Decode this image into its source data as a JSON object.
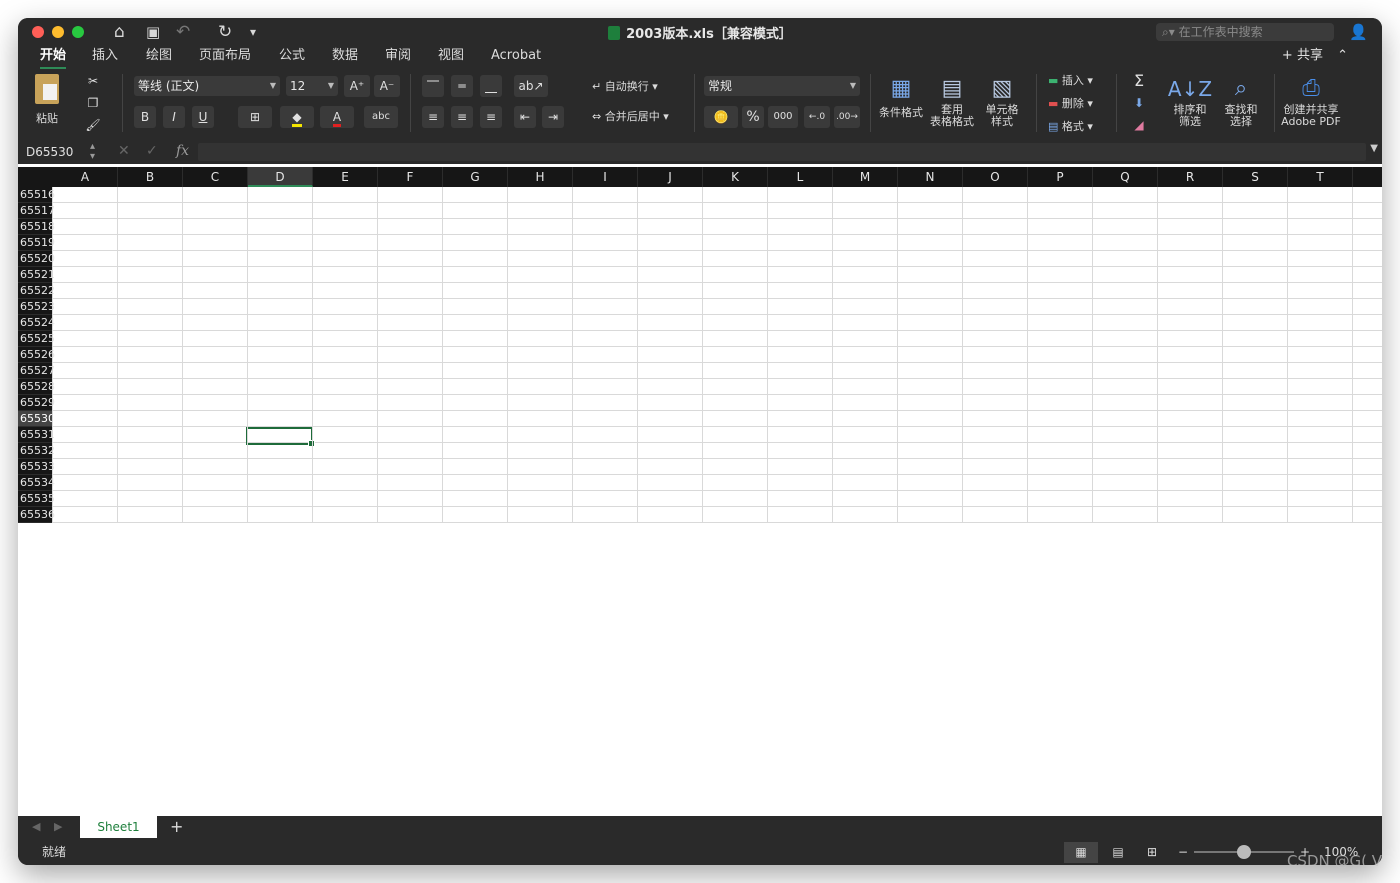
{
  "window": {
    "title": "2003版本.xls［兼容模式］",
    "search_placeholder": "在工作表中搜索",
    "share_label": "共享"
  },
  "tabs": [
    "开始",
    "插入",
    "绘图",
    "页面布局",
    "公式",
    "数据",
    "审阅",
    "视图",
    "Acrobat"
  ],
  "active_tab": "开始",
  "ribbon": {
    "paste": "粘贴",
    "font_name": "等线 (正文)",
    "font_size": "12",
    "bold": "B",
    "italic": "I",
    "underline": "U",
    "wrap_text": "自动换行",
    "merge_center": "合并后居中",
    "number_format": "常规",
    "percent": "%",
    "comma": "000",
    "conditional_format": "条件格式",
    "table_format_1": "套用",
    "table_format_2": "表格格式",
    "cell_style_1": "单元格",
    "cell_style_2": "样式",
    "insert": "插入",
    "delete": "删除",
    "format": "格式",
    "sort_filter_1": "排序和",
    "sort_filter_2": "筛选",
    "find_select_1": "查找和",
    "find_select_2": "选择",
    "adobe_1": "创建并共享",
    "adobe_2": "Adobe PDF"
  },
  "formula_bar": {
    "name_box": "D65530",
    "fx": "fx",
    "value": ""
  },
  "columns": [
    "A",
    "B",
    "C",
    "D",
    "E",
    "F",
    "G",
    "H",
    "I",
    "J",
    "K",
    "L",
    "M",
    "N",
    "O",
    "P",
    "Q",
    "R",
    "S",
    "T"
  ],
  "selected_column": "D",
  "rows": [
    "65516",
    "65517",
    "65518",
    "65519",
    "65520",
    "65521",
    "65522",
    "65523",
    "65524",
    "65525",
    "65526",
    "65527",
    "65528",
    "65529",
    "65530",
    "65531",
    "65532",
    "65533",
    "65534",
    "65535",
    "65536"
  ],
  "selected_row": "65530",
  "sheets": [
    "Sheet1"
  ],
  "status": {
    "ready": "就绪",
    "zoom": "100%"
  },
  "watermark": "CSDN @G( V"
}
